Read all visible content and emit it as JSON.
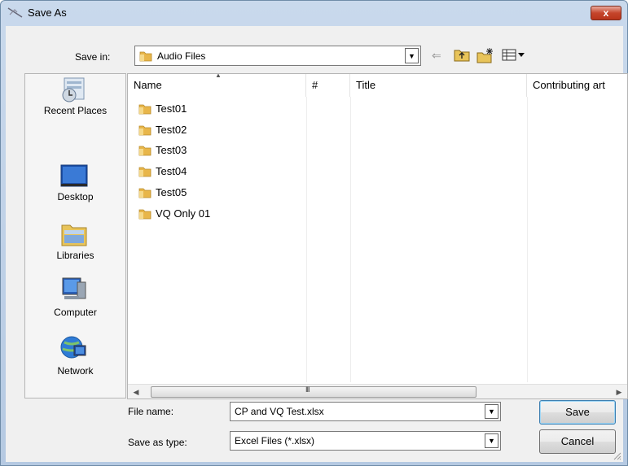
{
  "window": {
    "title": "Save As",
    "close_label": "x"
  },
  "toolbar": {
    "save_in_label": "Save in:",
    "save_in_value": "Audio Files",
    "back_icon": "back-arrow-icon",
    "up_icon": "up-folder-icon",
    "new_folder_icon": "new-folder-icon",
    "view_icon": "view-menu-icon"
  },
  "places": [
    {
      "label": "Recent Places",
      "icon": "recent-places-icon"
    },
    {
      "label": "Desktop",
      "icon": "desktop-icon"
    },
    {
      "label": "Libraries",
      "icon": "libraries-icon"
    },
    {
      "label": "Computer",
      "icon": "computer-icon"
    },
    {
      "label": "Network",
      "icon": "network-icon"
    }
  ],
  "filelist": {
    "columns": [
      "Name",
      "#",
      "Title",
      "Contributing art"
    ],
    "sort_column": "Name",
    "items": [
      "Test01",
      "Test02",
      "Test03",
      "Test04",
      "Test05",
      "VQ Only 01"
    ],
    "scroll_grip": "III"
  },
  "form": {
    "filename_label": "File name:",
    "filename_value": "CP and VQ Test.xlsx",
    "savetype_label": "Save as type:",
    "savetype_value": "Excel Files (*.xlsx)"
  },
  "buttons": {
    "save_label": "Save",
    "cancel_label": "Cancel"
  },
  "colors": {
    "folder": "#e8b64a",
    "close": "#c5452b",
    "title_bg": "#c9d9ec"
  }
}
